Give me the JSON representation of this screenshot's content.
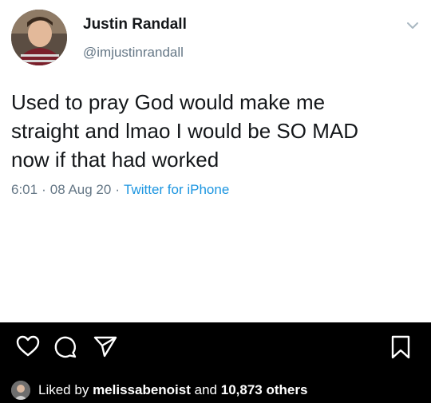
{
  "tweet": {
    "name": "Justin Randall",
    "handle": "@imjustinrandall",
    "body_lines": [
      "Used to pray God would make me",
      "straight and lmao I would be SO MAD",
      "now if that had worked"
    ],
    "time": "6:01",
    "date": "08 Aug 20",
    "source": "Twitter for iPhone",
    "separator": "·"
  },
  "instagram": {
    "liked_prefix": "Liked by",
    "liked_user": "melissabenoist",
    "liked_connector": "and",
    "liked_others": "10,873 others"
  },
  "colors": {
    "text": "#14171a",
    "muted": "#657786",
    "link": "#1b95e0",
    "bar": "#000000"
  }
}
